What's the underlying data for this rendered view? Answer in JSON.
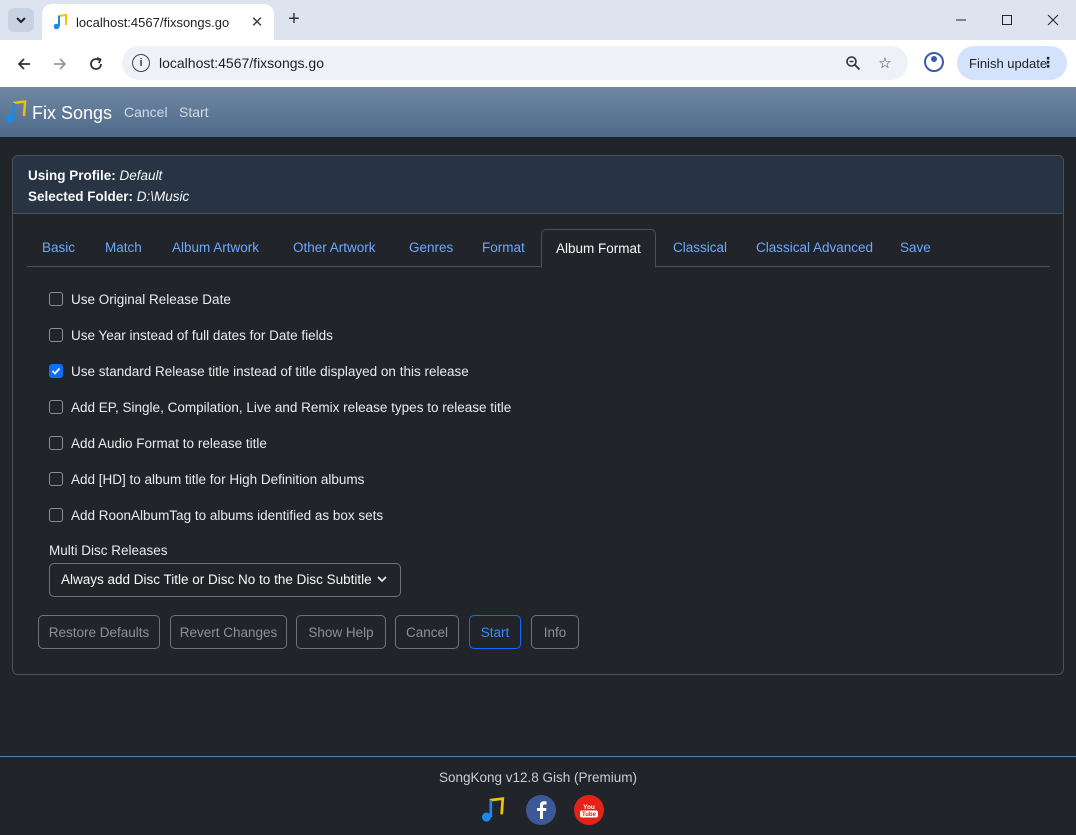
{
  "browser": {
    "tab_title": "localhost:4567/fixsongs.go",
    "url": "localhost:4567/fixsongs.go",
    "finish_update_label": "Finish update"
  },
  "app": {
    "brand": "Fix Songs",
    "nav": [
      "Cancel",
      "Start"
    ]
  },
  "profile": {
    "profile_label": "Using Profile:",
    "profile_value": "Default",
    "folder_label": "Selected Folder:",
    "folder_value": "D:\\Music"
  },
  "tabs": [
    {
      "label": "Basic",
      "active": false
    },
    {
      "label": "Match",
      "active": false
    },
    {
      "label": "Album Artwork",
      "active": false
    },
    {
      "label": "Other Artwork",
      "active": false
    },
    {
      "label": "Genres",
      "active": false
    },
    {
      "label": "Format",
      "active": false
    },
    {
      "label": "Album Format",
      "active": true
    },
    {
      "label": "Classical",
      "active": false
    },
    {
      "label": "Classical Advanced",
      "active": false
    },
    {
      "label": "Save",
      "active": false
    }
  ],
  "options": [
    {
      "label": "Use Original Release Date",
      "checked": false
    },
    {
      "label": "Use Year instead of full dates for Date fields",
      "checked": false
    },
    {
      "label": "Use standard Release title instead of title displayed on this release",
      "checked": true
    },
    {
      "label": "Add EP, Single, Compilation, Live and Remix release types to release title",
      "checked": false
    },
    {
      "label": "Add Audio Format to release title",
      "checked": false
    },
    {
      "label": "Add [HD] to album title for High Definition albums",
      "checked": false
    },
    {
      "label": "Add RoonAlbumTag to albums identified as box sets",
      "checked": false
    }
  ],
  "multi_disc": {
    "label": "Multi Disc Releases",
    "selected": "Always add Disc Title or Disc No to the Disc Subtitle"
  },
  "buttons": [
    "Restore Defaults",
    "Revert Changes",
    "Show Help",
    "Cancel",
    "Start",
    "Info"
  ],
  "footer": {
    "version": "SongKong v12.8 Gish (Premium)"
  },
  "colors": {
    "accent": "#0d6efd",
    "link": "#6ea8fe",
    "background": "#212529",
    "facebook": "#3b5998",
    "youtube": "#e62117"
  }
}
